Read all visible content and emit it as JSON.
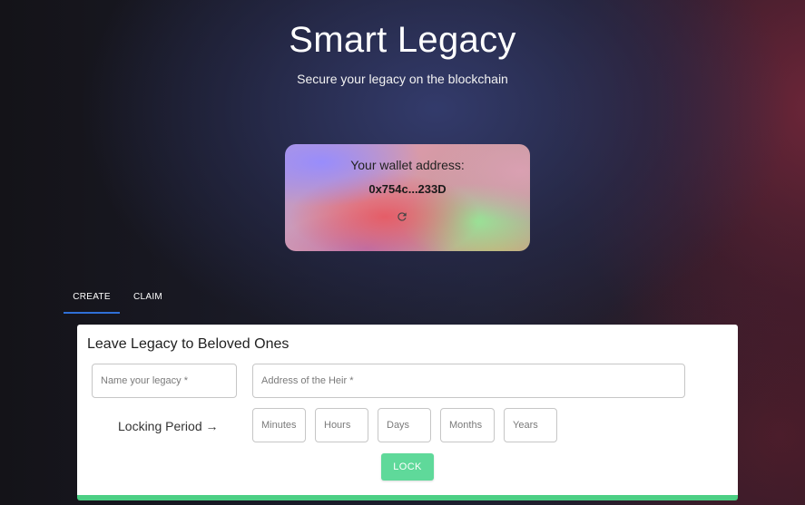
{
  "header": {
    "title": "Smart Legacy",
    "subtitle": "Secure your legacy on the blockchain"
  },
  "wallet": {
    "label": "Your wallet address:",
    "address": "0x754c...233D",
    "refresh_icon": "refresh-icon"
  },
  "tabs": [
    {
      "label": "CREATE",
      "active": true
    },
    {
      "label": "CLAIM",
      "active": false
    }
  ],
  "form": {
    "title": "Leave Legacy to Beloved Ones",
    "name_placeholder": "Name your legacy *",
    "heir_placeholder": "Address of the Heir *",
    "locking_label": "Locking Period →",
    "minutes_placeholder": "Minutes",
    "hours_placeholder": "Hours",
    "days_placeholder": "Days",
    "months_placeholder": "Months",
    "years_placeholder": "Years",
    "lock_label": "LOCK"
  },
  "colors": {
    "accent_green": "#5fd99a",
    "tab_indicator": "#2f6fd6"
  }
}
